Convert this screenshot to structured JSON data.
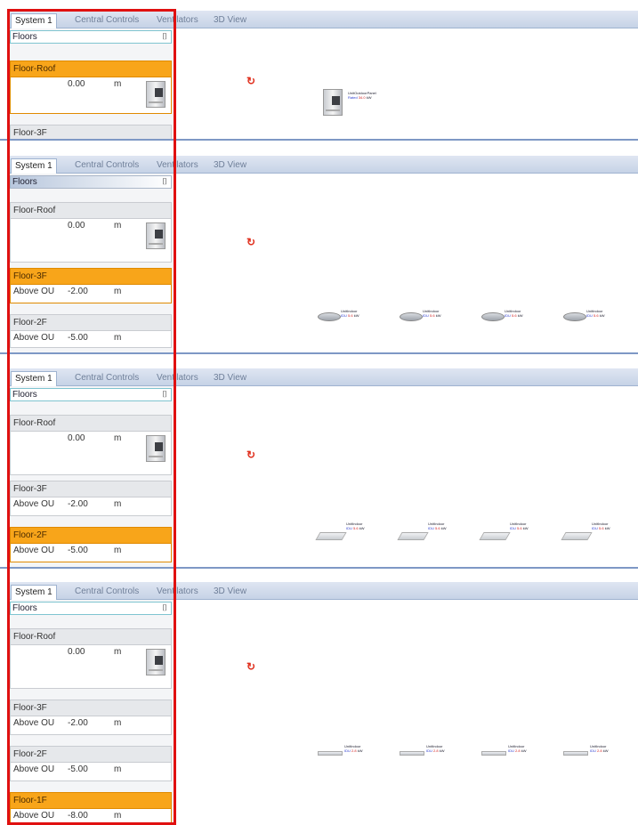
{
  "tabs": [
    "System 1",
    "Central Controls",
    "Ventilators",
    "3D View"
  ],
  "floors_label": "Floors",
  "pin_glyph": "⌷",
  "unit_m": "m",
  "floor_names": {
    "roof": "Floor-Roof",
    "f3": "Floor-3F",
    "f2": "Floor-2F",
    "f1": "Floor-1F"
  },
  "above_ou": "Above OU",
  "elevations": {
    "roof": "0.00",
    "f3": "-2.00",
    "f2": "-5.00",
    "f1": "-8.00"
  },
  "panels": [
    {
      "id": "p1",
      "selected_floor": "Floor-Roof"
    },
    {
      "id": "p2",
      "selected_floor": "Floor-3F"
    },
    {
      "id": "p3",
      "selected_floor": "Floor-2F"
    },
    {
      "id": "p4",
      "selected_floor": "Floor-1F"
    }
  ],
  "colors": {
    "selected": "#f8a51a",
    "highlight": "#e01010",
    "tab_border": "#9fb3d0"
  }
}
